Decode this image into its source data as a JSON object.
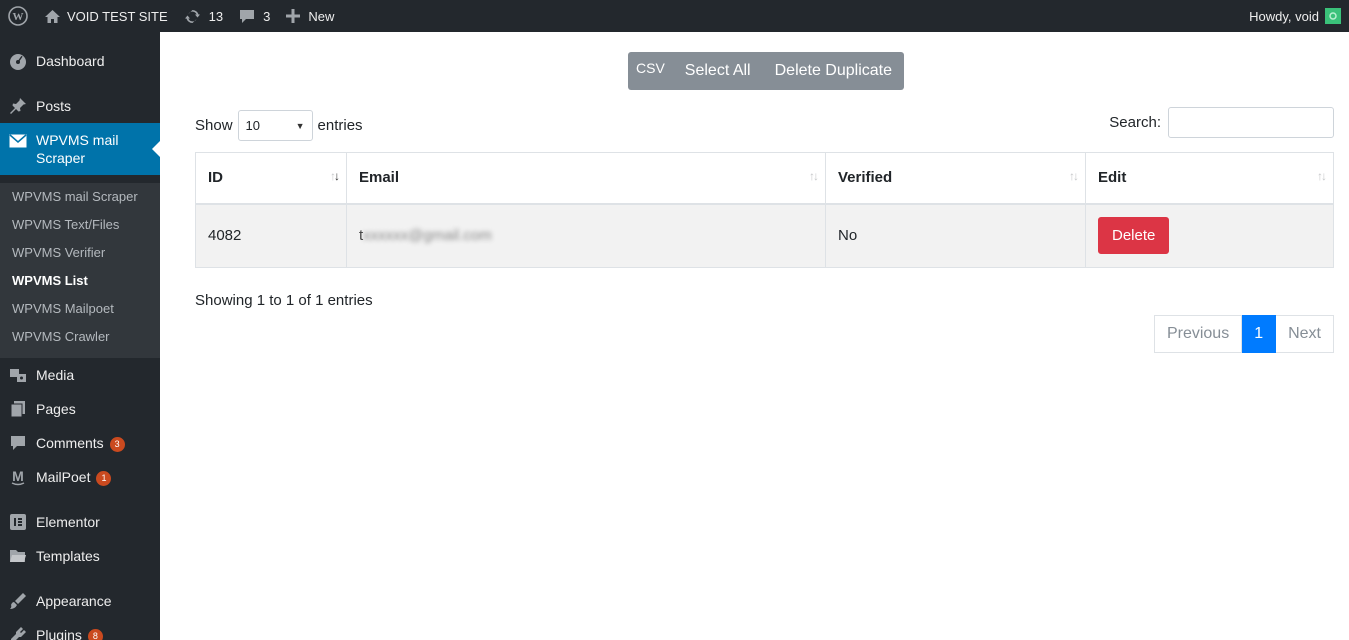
{
  "admin_bar": {
    "site_name": "VOID TEST SITE",
    "updates_count": "13",
    "comments_count": "3",
    "new_label": "New",
    "howdy": "Howdy, void"
  },
  "sidebar": {
    "items": [
      {
        "label": "Dashboard",
        "icon": "dashboard-icon"
      },
      {
        "label": "Posts",
        "icon": "pin-icon"
      },
      {
        "label": "WPVMS mail Scraper",
        "icon": "mail-icon"
      },
      {
        "label": "Media",
        "icon": "media-icon"
      },
      {
        "label": "Pages",
        "icon": "pages-icon"
      },
      {
        "label": "Comments",
        "icon": "comment-icon",
        "badge": "3"
      },
      {
        "label": "MailPoet",
        "icon": "mailpoet-icon",
        "badge": "1"
      },
      {
        "label": "Elementor",
        "icon": "elementor-icon"
      },
      {
        "label": "Templates",
        "icon": "folder-icon"
      },
      {
        "label": "Appearance",
        "icon": "brush-icon"
      },
      {
        "label": "Plugins",
        "icon": "plugin-icon",
        "badge": "8"
      }
    ],
    "submenu": [
      "WPVMS mail Scraper",
      "WPVMS Text/Files",
      "WPVMS Verifier",
      "WPVMS List",
      "WPVMS Mailpoet",
      "WPVMS Crawler"
    ],
    "active_submenu": "WPVMS List"
  },
  "toolbar": {
    "csv": "CSV",
    "select_all": "Select All",
    "delete_duplicate": "Delete Duplicate"
  },
  "table_controls": {
    "show": "Show",
    "entries_value": "10",
    "entries": "entries",
    "search_label": "Search:",
    "search_value": ""
  },
  "table": {
    "headers": [
      "ID",
      "Email",
      "Verified",
      "Edit"
    ],
    "rows": [
      {
        "id": "4082",
        "email_visible_start": "t",
        "email_visible_end": "@gmail.com",
        "verified": "No",
        "action": "Delete"
      }
    ]
  },
  "info": "Showing 1 to 1 of 1 entries",
  "pagination": {
    "previous": "Previous",
    "current": "1",
    "next": "Next"
  },
  "colors": {
    "adminbar": "#23282d",
    "menu_active": "#0073aa",
    "danger": "#dc3545",
    "primary": "#007bff",
    "secondary": "#868e96"
  }
}
